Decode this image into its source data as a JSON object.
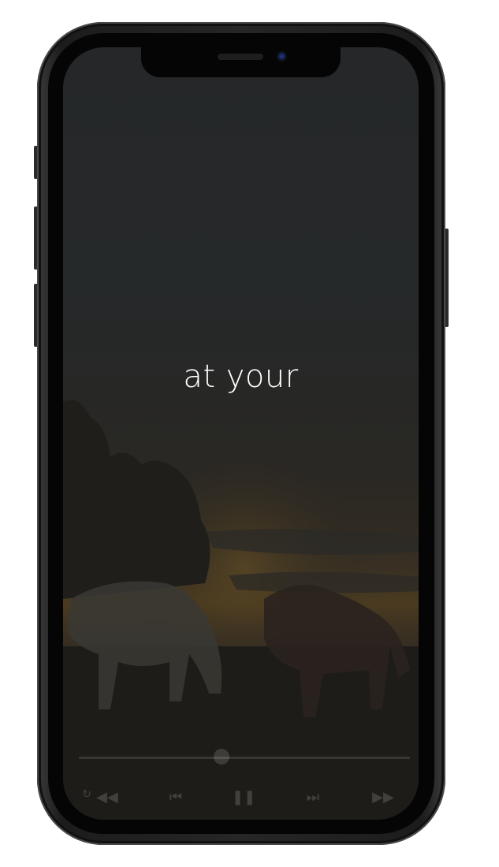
{
  "screen": {
    "lyric_text": "at your"
  },
  "player": {
    "progress": 0.43,
    "controls": [
      {
        "name": "rewind",
        "icon": "rewind-icon",
        "glyph": "◀◀"
      },
      {
        "name": "previous",
        "icon": "skip-previous-icon",
        "glyph": "⏮"
      },
      {
        "name": "pause",
        "icon": "pause-icon",
        "glyph": "❚❚"
      },
      {
        "name": "next",
        "icon": "skip-next-icon",
        "glyph": "⏭"
      },
      {
        "name": "fast-forward",
        "icon": "fast-forward-icon",
        "glyph": "▶▶"
      }
    ]
  },
  "colors": {
    "lyric_text": "#ffffff",
    "phone_frame": "#262626",
    "screen_overlay": "#252728"
  }
}
